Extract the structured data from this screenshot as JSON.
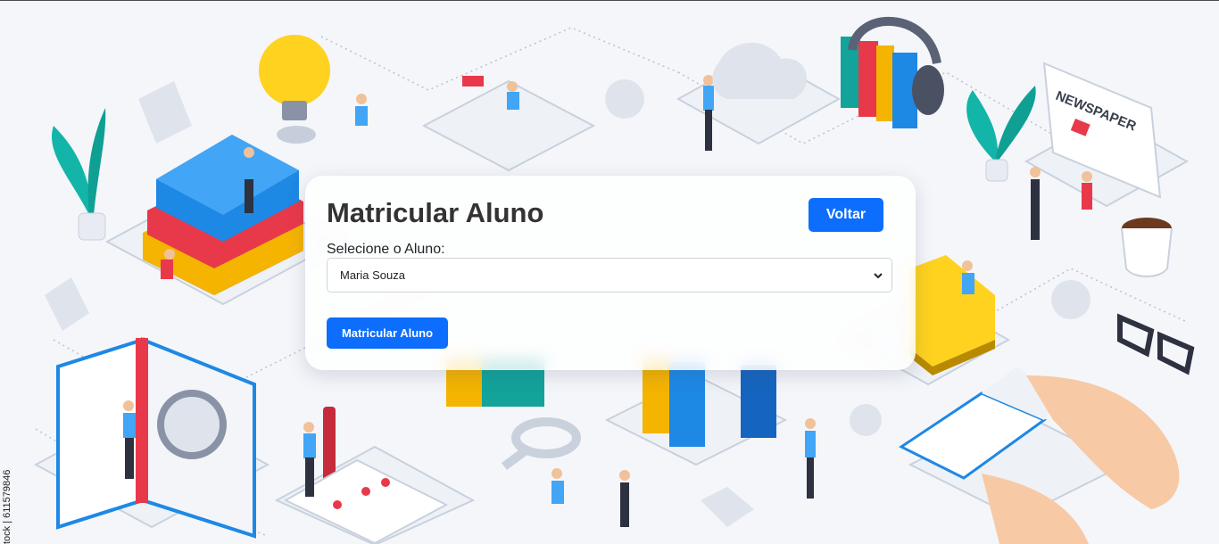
{
  "card": {
    "title": "Matricular Aluno",
    "back_label": "Voltar",
    "select_label": "Selecione o Aluno:",
    "selected_student": "Maria Souza",
    "enroll_label": "Matricular Aluno"
  },
  "background": {
    "newspaper_text": "NEWSPAPER",
    "watermark": "tock | 611579846"
  },
  "colors": {
    "primary": "#0d6efd",
    "title": "#333333"
  }
}
